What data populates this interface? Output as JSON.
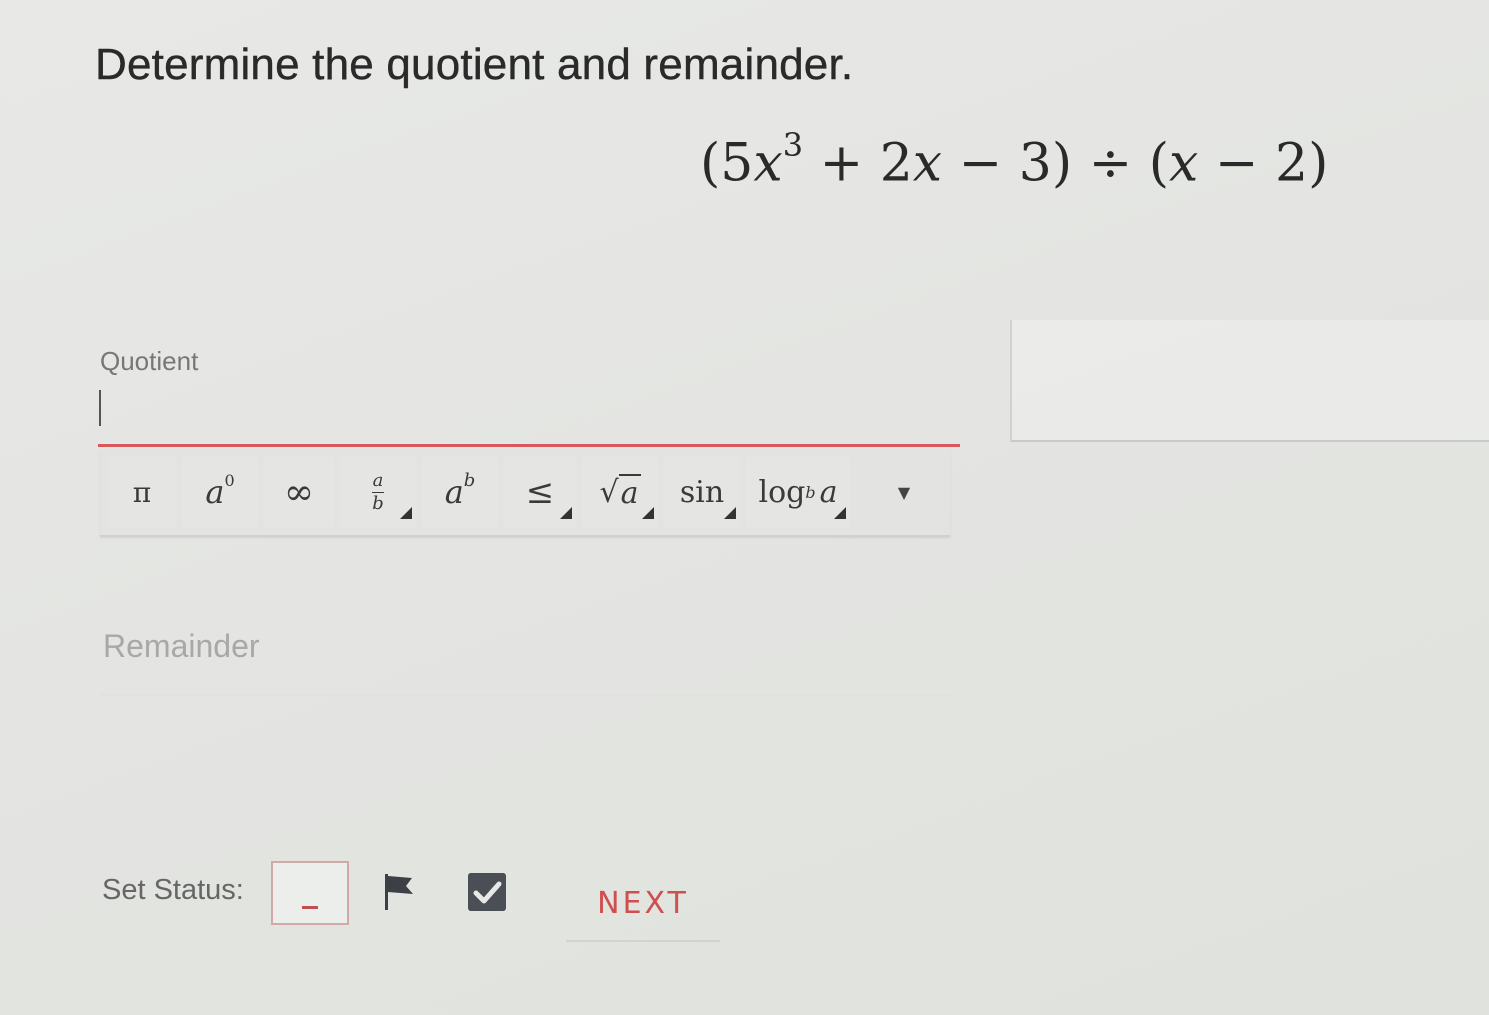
{
  "question": {
    "title": "Determine the quotient and remainder.",
    "expression": {
      "part1": "(5",
      "var1": "x",
      "exp1": "3",
      "part2": " + 2",
      "var2": "x",
      "part3": " − 3) ÷ (",
      "var3": "x",
      "part4": " − 2)"
    }
  },
  "quotient": {
    "label": "Quotient",
    "value": ""
  },
  "toolbar": {
    "pi": "π",
    "a0_base": "a",
    "a0_exp": "0",
    "infinity": "∞",
    "frac_num": "a",
    "frac_den": "b",
    "pow_base": "a",
    "pow_exp": "b",
    "le": "≤",
    "sqrt_sign": "√",
    "sqrt_arg": "a",
    "sin": "sin",
    "log_word": "log",
    "log_base": "b",
    "log_arg": "a",
    "more": "▼"
  },
  "remainder": {
    "label": "Remainder",
    "value": ""
  },
  "status": {
    "label": "Set Status:",
    "box_value": ""
  },
  "next_label": "NEXT",
  "colors": {
    "accent": "#cf4f4f",
    "check_bg": "#4a4f55"
  }
}
